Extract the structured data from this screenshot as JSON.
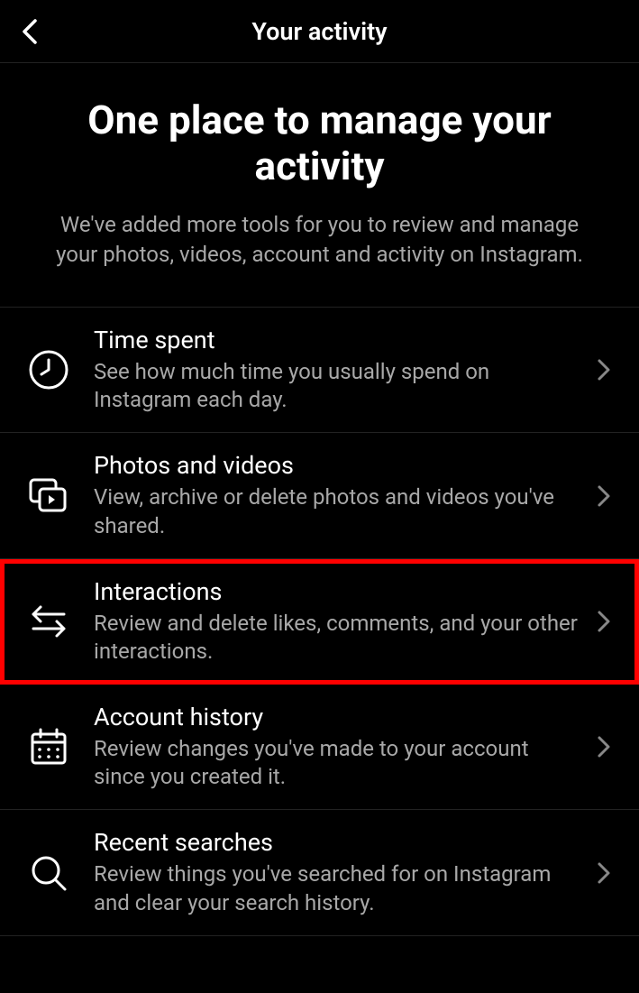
{
  "header": {
    "title": "Your activity"
  },
  "intro": {
    "title": "One place to manage your activity",
    "subtitle": "We've added more tools for you to review and manage your photos, videos, account and activity on Instagram."
  },
  "items": [
    {
      "title": "Time spent",
      "desc": "See how much time you usually spend on Instagram each day."
    },
    {
      "title": "Photos and videos",
      "desc": "View, archive or delete photos and videos you've shared."
    },
    {
      "title": "Interactions",
      "desc": "Review and delete likes, comments, and your other interactions."
    },
    {
      "title": "Account history",
      "desc": "Review changes you've made to your account since you created it."
    },
    {
      "title": "Recent searches",
      "desc": "Review things you've searched for on Instagram and clear your search history."
    }
  ]
}
